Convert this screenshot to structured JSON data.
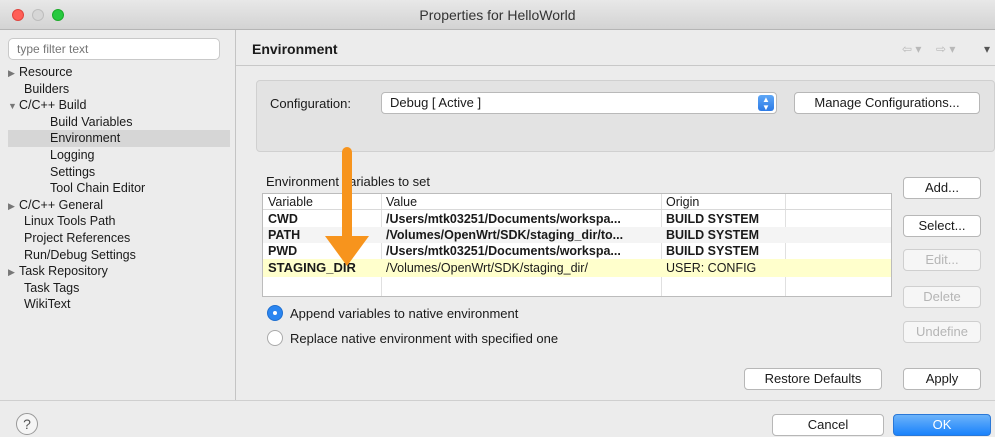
{
  "window": {
    "title": "Properties for HelloWorld"
  },
  "filter": {
    "placeholder": "type filter text"
  },
  "tree": [
    {
      "label": "Resource",
      "arrow": "▶"
    },
    {
      "label": "Builders"
    },
    {
      "label": "C/C++ Build",
      "arrow": "▼"
    },
    {
      "label": "Build Variables"
    },
    {
      "label": "Environment"
    },
    {
      "label": "Logging"
    },
    {
      "label": "Settings"
    },
    {
      "label": "Tool Chain Editor"
    },
    {
      "label": "C/C++ General",
      "arrow": "▶"
    },
    {
      "label": "Linux Tools Path"
    },
    {
      "label": "Project References"
    },
    {
      "label": "Run/Debug Settings"
    },
    {
      "label": "Task Repository",
      "arrow": "▶"
    },
    {
      "label": "Task Tags"
    },
    {
      "label": "WikiText"
    }
  ],
  "header": {
    "title": "Environment",
    "nav_back": "⇦ ▾",
    "nav_forward": "⇨ ▾",
    "nav_menu": "▾"
  },
  "config": {
    "label": "Configuration:",
    "value": "Debug  [ Active ]",
    "manage_button": "Manage Configurations..."
  },
  "env_table": {
    "label": "Environment variables to set",
    "columns": [
      "Variable",
      "Value",
      "Origin"
    ],
    "rows": [
      {
        "variable": "CWD",
        "value": "/Users/mtk03251/Documents/workspa...",
        "origin": "BUILD SYSTEM"
      },
      {
        "variable": "PATH",
        "value": "/Volumes/OpenWrt/SDK/staging_dir/to...",
        "origin": "BUILD SYSTEM"
      },
      {
        "variable": "PWD",
        "value": "/Users/mtk03251/Documents/workspa...",
        "origin": "BUILD SYSTEM"
      },
      {
        "variable": "STAGING_DIR",
        "value": "/Volumes/OpenWrt/SDK/staging_dir/",
        "origin": "USER: CONFIG"
      }
    ]
  },
  "side_buttons": {
    "add": "Add...",
    "select": "Select...",
    "edit": "Edit...",
    "delete": "Delete",
    "undefine": "Undefine"
  },
  "options": {
    "append": "Append variables to native environment",
    "replace": "Replace native environment with specified one",
    "selected": "append"
  },
  "actions": {
    "restore_defaults": "Restore Defaults",
    "apply": "Apply",
    "cancel": "Cancel",
    "ok": "OK",
    "help": "?"
  },
  "colors": {
    "highlight_row": "#ffffcc",
    "arrow": "#f7941d",
    "accent": "#2a85f0"
  }
}
